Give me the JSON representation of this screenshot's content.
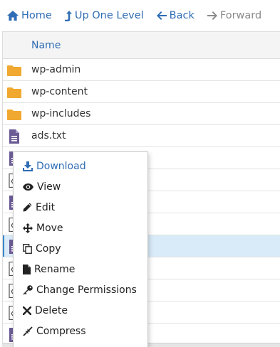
{
  "toolbar": {
    "home_label": "Home",
    "up_label": "Up One Level",
    "back_label": "Back",
    "forward_label": "Forward"
  },
  "table": {
    "header_name": "Name",
    "rows": [
      {
        "type": "folder",
        "name": "wp-admin"
      },
      {
        "type": "folder",
        "name": "wp-content"
      },
      {
        "type": "folder",
        "name": "wp-includes"
      },
      {
        "type": "text-file",
        "name": "ads.txt"
      },
      {
        "type": "text-file",
        "name": ""
      },
      {
        "type": "code-file",
        "name": ""
      },
      {
        "type": "text-file",
        "name": ""
      },
      {
        "type": "code-file",
        "name": ""
      },
      {
        "type": "text-file",
        "name": "",
        "selected": true
      },
      {
        "type": "code-file",
        "name": ""
      },
      {
        "type": "code-file",
        "name": ""
      },
      {
        "type": "code-file",
        "name": ""
      },
      {
        "type": "text-file",
        "name": ""
      }
    ]
  },
  "context_menu": {
    "download": "Download",
    "view": "View",
    "edit": "Edit",
    "move": "Move",
    "copy": "Copy",
    "rename": "Rename",
    "change_permissions": "Change Permissions",
    "delete": "Delete",
    "compress": "Compress"
  },
  "colors": {
    "accent": "#2f6db5",
    "folder": "#f0a830",
    "file": "#6b5b95",
    "selected_row": "#d9ebf9"
  }
}
